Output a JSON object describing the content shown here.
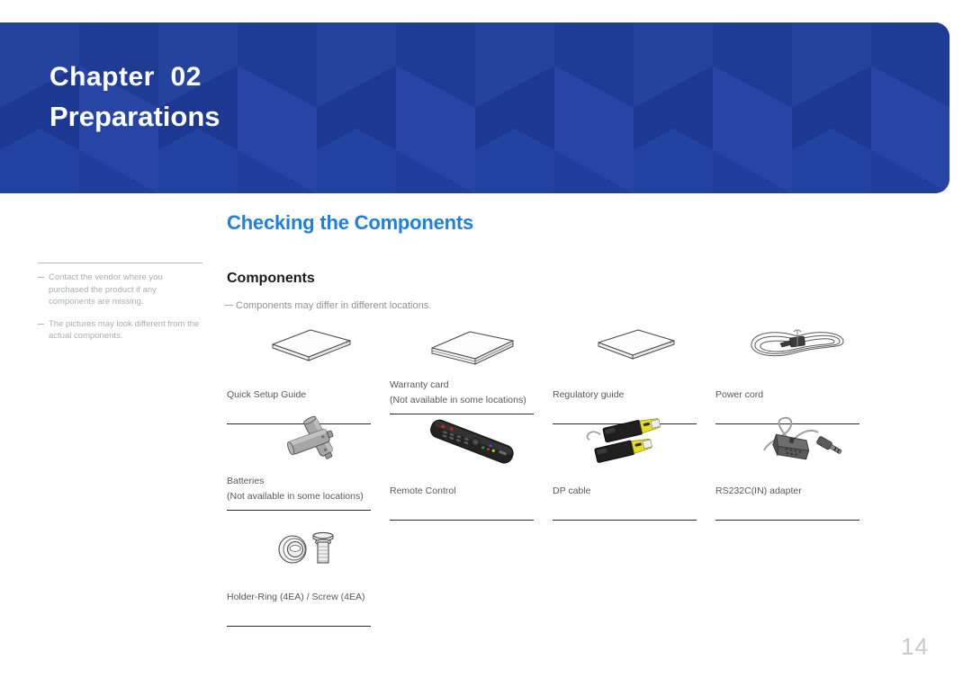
{
  "banner": {
    "chapter_label": "Chapter  02",
    "chapter_title": "Preparations",
    "background_color": "#213e9c"
  },
  "section": {
    "title": "Checking the Components",
    "accent_color": "#1d7fe0",
    "subsection_title": "Components",
    "inline_note": "Components may differ in different locations."
  },
  "side_notes": [
    "Contact the vendor where you purchased the product if any components are missing.",
    "The pictures may look different from the actual components."
  ],
  "components": [
    {
      "icon": "quick-setup-guide-icon",
      "label": "Quick Setup Guide",
      "sublabel": ""
    },
    {
      "icon": "warranty-card-icon",
      "label": "Warranty card",
      "sublabel": "(Not available in some locations)"
    },
    {
      "icon": "regulatory-guide-icon",
      "label": "Regulatory guide",
      "sublabel": ""
    },
    {
      "icon": "power-cord-icon",
      "label": "Power cord",
      "sublabel": ""
    },
    {
      "icon": "batteries-icon",
      "label": "Batteries",
      "sublabel": "(Not available in some locations)"
    },
    {
      "icon": "remote-control-icon",
      "label": "Remote Control",
      "sublabel": ""
    },
    {
      "icon": "dp-cable-icon",
      "label": "DP cable",
      "sublabel": ""
    },
    {
      "icon": "rs232c-adapter-icon",
      "label": "RS232C(IN) adapter",
      "sublabel": ""
    },
    {
      "icon": "holder-ring-screw-icon",
      "label": "Holder-Ring (4EA) / Screw (4EA)",
      "sublabel": ""
    }
  ],
  "page": {
    "number": "14"
  }
}
